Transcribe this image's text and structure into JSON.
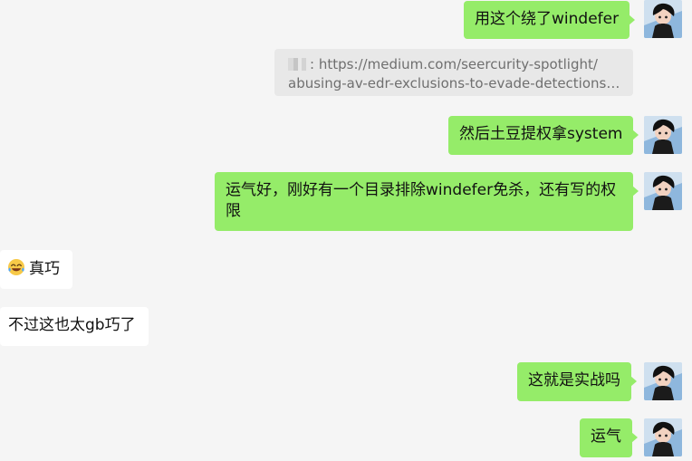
{
  "messages": [
    {
      "side": "right",
      "text": "用这个绕了windefer"
    },
    {
      "side": "right",
      "type": "link",
      "prefix": ":",
      "line1": "https://medium.com/seercurity-spotlight/",
      "line2": "abusing-av-edr-exclusions-to-evade-detections-2..."
    },
    {
      "side": "right",
      "text": "然后土豆提权拿system"
    },
    {
      "side": "right",
      "text": "运气好，刚好有一个目录排除windefer免杀，还有写的权限"
    },
    {
      "side": "left",
      "text": "真巧",
      "emoji": "joy-tears-icon"
    },
    {
      "side": "left",
      "text": "不过这也太gb巧了"
    },
    {
      "side": "right",
      "text": "这就是实战吗"
    },
    {
      "side": "right",
      "text": "运气"
    }
  ],
  "colors": {
    "background": "#f5f5f5",
    "right_bubble": "#95ec69",
    "left_bubble": "#ffffff",
    "link_card": "#e8e8e8"
  }
}
